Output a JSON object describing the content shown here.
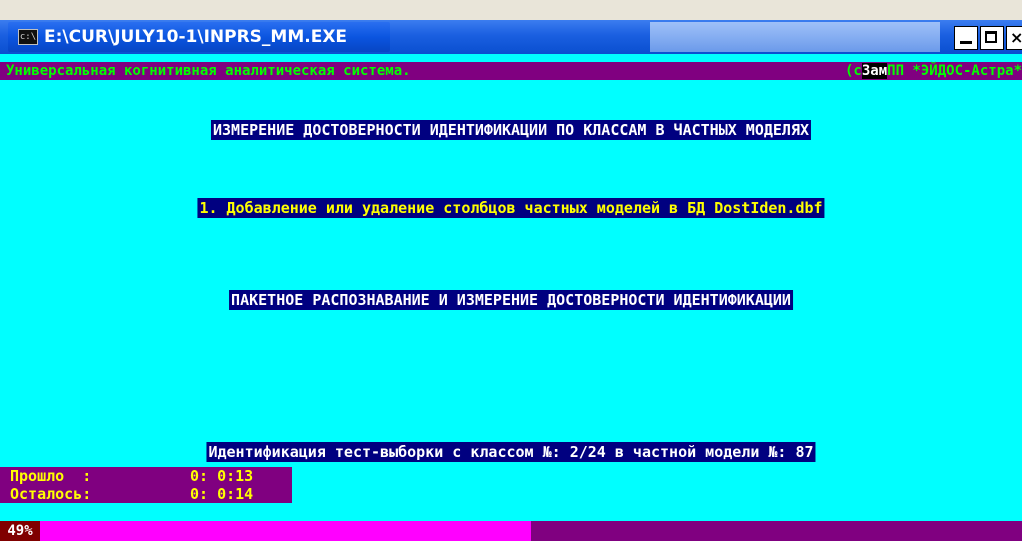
{
  "window": {
    "title": "E:\\CUR\\JULY10-1\\INPRS_MM.EXE",
    "icon_name": "console-icon",
    "close_glyph": "×"
  },
  "status_bar": {
    "left_text": "Универсальная когнитивная аналитическая система.",
    "right_prefix": "(c",
    "right_highlight": "Зам",
    "right_suffix": "ПП *ЭЙДОС-Астра*"
  },
  "screen": {
    "heading_1": "ИЗМЕРЕНИЕ ДОСТОВЕРНОСТИ ИДЕНТИФИКАЦИИ ПО КЛАССАМ В ЧАСТНЫХ МОДЕЛЯХ",
    "menu_item_1": "1. Добавление или удаление столбцов частных моделей в БД DostIden.dbf",
    "heading_2": "ПАКЕТНОЕ РАСПОЗНАВАНИЕ И ИЗМЕРЕНИЕ ДОСТОВЕРНОСТИ ИДЕНТИФИКАЦИИ",
    "heading_3": "Идентификация тест-выборки с классом №: 2/24 в частной модели №: 87"
  },
  "timer": {
    "elapsed_label": "Прошло  :",
    "elapsed_value": "0: 0:13",
    "remaining_label": "Осталось:",
    "remaining_value": "0: 0:14"
  },
  "progress": {
    "label": "49%",
    "fraction": 0.52
  },
  "colors": {
    "console_bg": "#00ffff",
    "status_bg": "#800080",
    "heading_bg": "#000080",
    "progress_fill": "#ff00ff",
    "title_bar": "#0a4fd0"
  }
}
